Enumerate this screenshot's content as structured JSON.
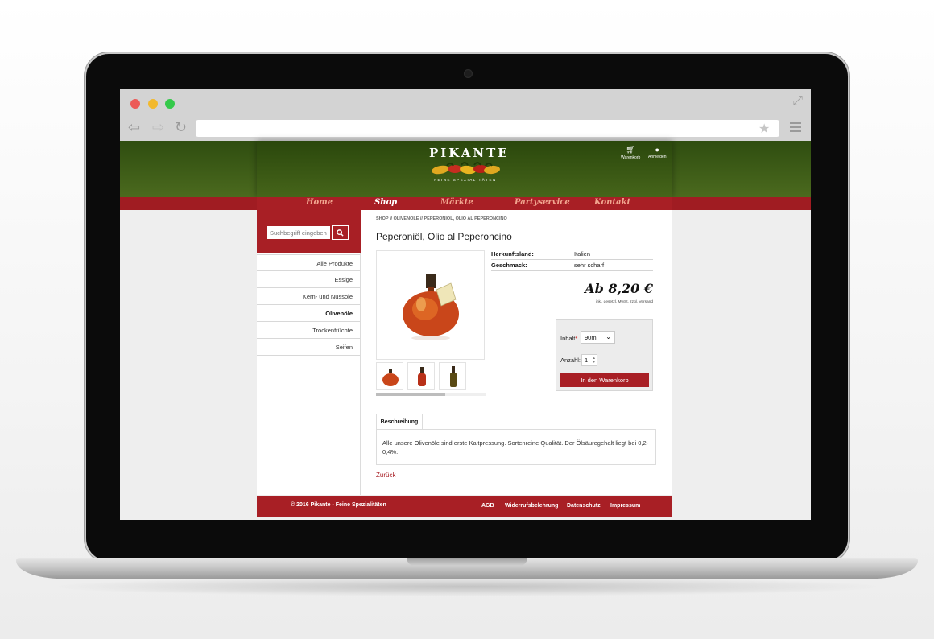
{
  "site": {
    "logo": "PIKANTE",
    "logo_sub": "FEINE SPEZIALITÄTEN",
    "cart_label": "Warenkorb",
    "login_label": "Anmelden"
  },
  "nav": {
    "items": [
      {
        "label": "Home"
      },
      {
        "label": "Shop",
        "active": true
      },
      {
        "label": "Märkte"
      },
      {
        "label": "Partyservice"
      },
      {
        "label": "Kontakt"
      }
    ]
  },
  "sidebar": {
    "search_placeholder": "Suchbegriff eingeben",
    "categories": [
      {
        "label": "Alle Produkte"
      },
      {
        "label": "Essige"
      },
      {
        "label": "Kern- und Nussöle"
      },
      {
        "label": "Olivenöle",
        "active": true
      },
      {
        "label": "Trockenfrüchte"
      },
      {
        "label": "Seifen"
      }
    ]
  },
  "product": {
    "breadcrumb": "SHOP // OLIVENÖLE // PEPERONIÖL, OLIO AL PEPERONCINO",
    "title": "Peperoniöl, Olio al Peperoncino",
    "attributes": [
      {
        "key": "Herkunftsland:",
        "value": "Italien"
      },
      {
        "key": "Geschmack:",
        "value": "sehr scharf"
      }
    ],
    "price": "Ab 8,20 €",
    "tax_note": "inkl. gesetzl. MwSt. zzgl. Versand",
    "content_label": "Inhalt",
    "content_required": "*",
    "content_value": "90ml",
    "quantity_label": "Anzahl:",
    "quantity_value": "1",
    "add_to_cart": "In den Warenkorb",
    "tab_label": "Beschreibung",
    "description": "Alle unsere Olivenöle sind erste Kaltpressung. Sortenreine Qualität. Der Ölsäuregehalt liegt bei 0,2-0,4%.",
    "back_link": "Zurück"
  },
  "footer": {
    "copyright": "© 2016 Pikante - Feine Spezialitäten",
    "links": [
      {
        "label": "AGB"
      },
      {
        "label": "Widerrufsbelehrung"
      },
      {
        "label": "Datenschutz"
      },
      {
        "label": "Impressum"
      }
    ]
  },
  "colors": {
    "brand_red": "#a81f25",
    "header_green": "#3b5a15"
  }
}
